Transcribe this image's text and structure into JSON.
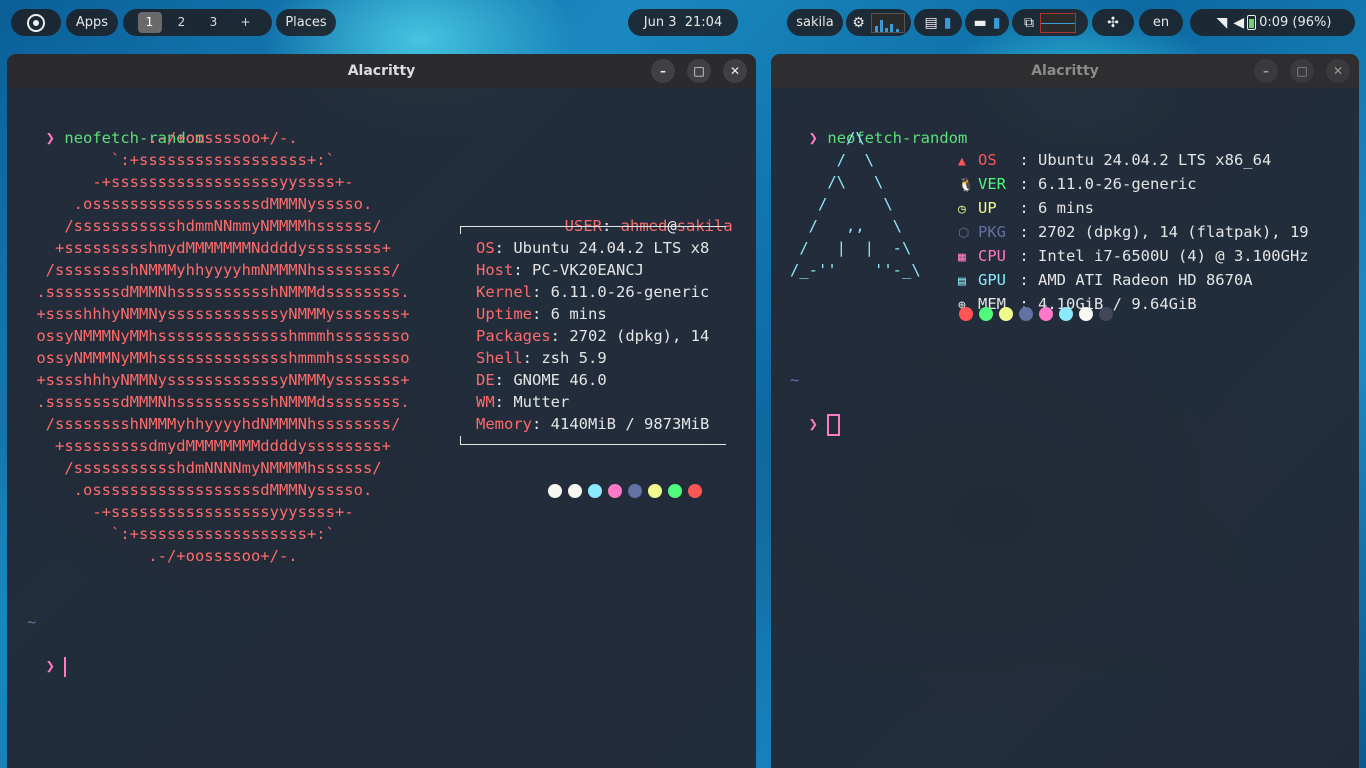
{
  "panel": {
    "apps": "Apps",
    "workspaces": [
      "1",
      "2",
      "3",
      "+"
    ],
    "places": "Places",
    "clock": "Jun 3  21:04",
    "user": "sakila",
    "lang": "en",
    "battery": "0:09 (96%)"
  },
  "left_window": {
    "title": "Alacritty",
    "prompt": "❯",
    "command": "neofetch-random",
    "art": [
      "             .-/+oossssoo+/-.",
      "         `:+ssssssssssssssssss+:`",
      "       -+ssssssssssssssssssyyssss+-",
      "     .ossssssssssssssssssdMMMNysssso.",
      "    /ssssssssssshdmmNNmmyNMMMMhssssss/",
      "   +ssssssssshmydMMMMMMMNddddyssssssss+",
      "  /sssssssshNMMMyhhyyyyhmNMMMNhssssssss/",
      " .ssssssssdMMMNhsssssssssshNMMMdssssssss.",
      " +sssshhhyNMMNyssssssssssssyNMMMysssssss+",
      " ossyNMMMNyMMhsssssssssssssshmmmhssssssso",
      " ossyNMMMNyMMhsssssssssssssshmmmhssssssso",
      " +sssshhhyNMMNyssssssssssssyNMMMysssssss+",
      " .ssssssssdMMMNhsssssssssshNMMMdssssssss.",
      "  /sssssssshNMMMyhhyyyyhdNMMMNhssssssss/",
      "   +sssssssssdmydMMMMMMMMddddyssssssss+",
      "    /ssssssssssshdmNNNNmyNMMMMhssssss/",
      "     .ossssssssssssssssssdMMMNysssso.",
      "       -+sssssssssssssssssyyyssss+-",
      "         `:+ssssssssssssssssss+:`",
      "             .-/+oossssoo+/-."
    ],
    "user_label": "USER",
    "user_name": "ahmed",
    "at": "@",
    "host_name": "sakila",
    "info": [
      {
        "key": "OS",
        "value": "Ubuntu 24.04.2 LTS x8"
      },
      {
        "key": "Host",
        "value": "PC-VK20EANCJ"
      },
      {
        "key": "Kernel",
        "value": "6.11.0-26-generic"
      },
      {
        "key": "Uptime",
        "value": "6 mins"
      },
      {
        "key": "Packages",
        "value": "2702 (dpkg), 14"
      },
      {
        "key": "Shell",
        "value": "zsh 5.9"
      },
      {
        "key": "DE",
        "value": "GNOME 46.0"
      },
      {
        "key": "WM",
        "value": "Mutter"
      },
      {
        "key": "Memory",
        "value": "4140MiB / 9873MiB"
      }
    ],
    "palette": [
      "#f8f8f2",
      "#f8f8f2",
      "#8be9fd",
      "#ff79c6",
      "#6272a4",
      "#f1fa8c",
      "#50fa7b",
      "#ff5555"
    ],
    "tilde": "~",
    "prompt2": "❯"
  },
  "right_window": {
    "title": "Alacritty",
    "prompt": "❯",
    "command": "neofetch-random",
    "art": [
      "      /\\",
      "     /  \\",
      "    /\\   \\",
      "   /      \\",
      "  /   ,,   \\",
      " /   |  |  -\\",
      "/_-''    ''-_\\"
    ],
    "info": [
      {
        "icon": "▲",
        "key": "OS",
        "value": "Ubuntu 24.04.2 LTS x86_64",
        "color": "#ff5555"
      },
      {
        "icon": "🐧",
        "key": "VER",
        "value": "6.11.0-26-generic",
        "color": "#50fa7b"
      },
      {
        "icon": "◷",
        "key": "UP",
        "value": "6 mins",
        "color": "#f1fa8c"
      },
      {
        "icon": "⬡",
        "key": "PKG",
        "value": "2702 (dpkg), 14 (flatpak), 19",
        "color": "#6272a4"
      },
      {
        "icon": "▦",
        "key": "CPU",
        "value": "Intel i7-6500U (4) @ 3.100GHz",
        "color": "#ff79c6"
      },
      {
        "icon": "▤",
        "key": "GPU",
        "value": "AMD ATI Radeon HD 8670A",
        "color": "#8be9fd"
      },
      {
        "icon": "⊕",
        "key": "MEM",
        "value": "4.10GiB / 9.64GiB",
        "color": "#e5e5e5"
      }
    ],
    "palette": [
      "#ff5555",
      "#50fa7b",
      "#f1fa8c",
      "#6272a4",
      "#ff79c6",
      "#8be9fd",
      "#f8f8f2",
      "#44475a"
    ],
    "tilde": "~",
    "prompt2": "❯"
  }
}
